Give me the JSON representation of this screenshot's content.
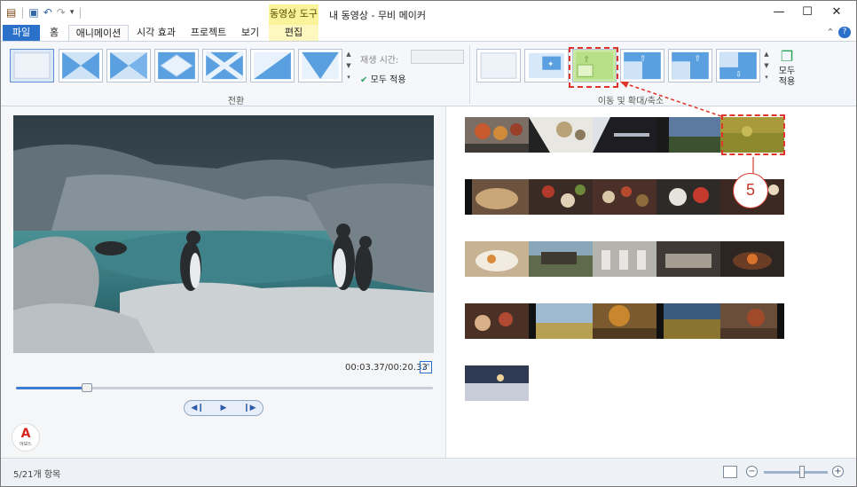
{
  "titlebar": {
    "app_title": "내 동영상 - 무비 메이커",
    "context_tab": "동영상 도구",
    "minimize": "—",
    "maximize": "☐",
    "close": "✕"
  },
  "tabs": {
    "file": "파일",
    "home": "홈",
    "animations": "애니메이션",
    "visual_effects": "시각 효과",
    "project": "프로젝트",
    "view": "보기",
    "edit": "편집"
  },
  "ribbon": {
    "transitions_label": "전환",
    "duration_label": "재생 시간:",
    "duration_value": "",
    "apply_all_small": "모두 적용",
    "panzoom_label": "이동 및 확대/축소",
    "apply_all_big": "모두 적용"
  },
  "preview": {
    "timecode": "00:03.37/00:20.33",
    "progress": 0.17
  },
  "status": {
    "items_text": "5/21개 항목",
    "zoom_level": 0.6
  },
  "logo": {
    "letter": "A",
    "name": "아보느"
  },
  "annotation": {
    "number": "5"
  },
  "colors": {
    "accent": "#2b70c9",
    "annotation": "#e0332a",
    "context_tab": "#fbf39a"
  }
}
